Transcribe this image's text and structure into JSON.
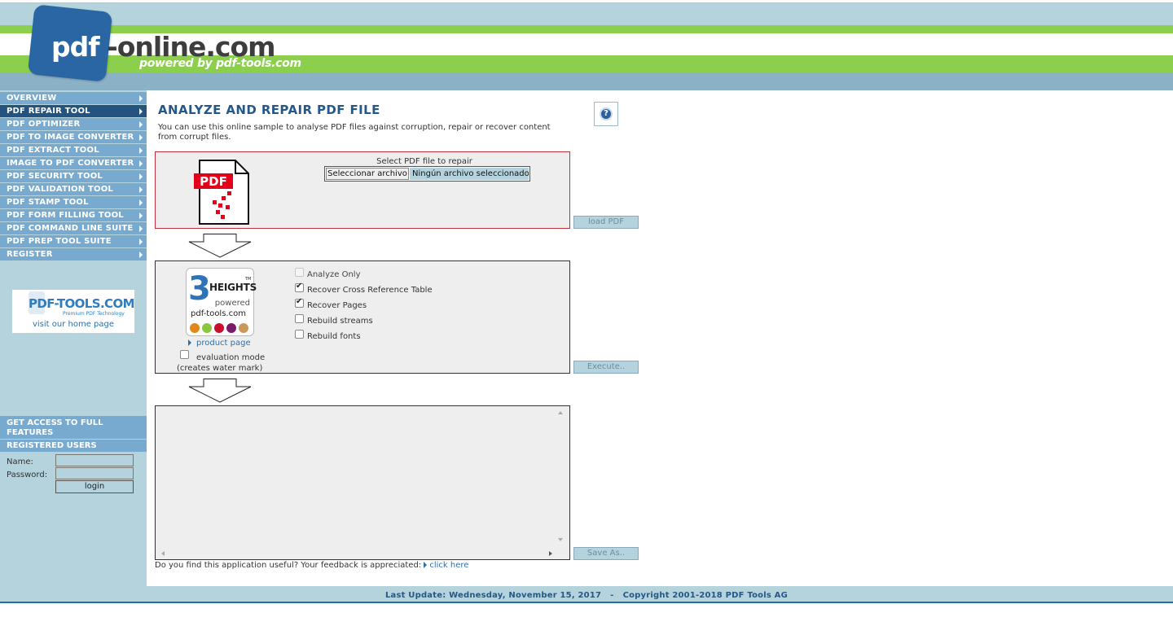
{
  "brand": {
    "logo_pdf": "pdf",
    "logo_rest": "-online.com",
    "powered": "powered by pdf-tools.com"
  },
  "nav": [
    {
      "label": "OVERVIEW",
      "active": false
    },
    {
      "label": "PDF REPAIR TOOL",
      "active": true
    },
    {
      "label": "PDF OPTIMIZER",
      "active": false
    },
    {
      "label": "PDF TO IMAGE CONVERTER",
      "active": false
    },
    {
      "label": "PDF EXTRACT TOOL",
      "active": false
    },
    {
      "label": "IMAGE TO PDF CONVERTER",
      "active": false
    },
    {
      "label": "PDF SECURITY TOOL",
      "active": false
    },
    {
      "label": "PDF VALIDATION TOOL",
      "active": false
    },
    {
      "label": "PDF STAMP TOOL",
      "active": false
    },
    {
      "label": "PDF FORM FILLING TOOL",
      "active": false
    },
    {
      "label": "PDF COMMAND LINE SUITE",
      "active": false
    },
    {
      "label": "PDF PREP TOOL SUITE",
      "active": false
    },
    {
      "label": "REGISTER",
      "active": false
    }
  ],
  "partner": {
    "logo": "PDF-TOOLS.COM",
    "tagline": "Premium PDF Technology",
    "visit": "visit our home page"
  },
  "access": {
    "heading": "GET ACCESS TO FULL FEATURES",
    "registered": "REGISTERED USERS",
    "name_label": "Name:",
    "password_label": "Password:",
    "login_label": "login",
    "name_value": "",
    "password_value": ""
  },
  "main": {
    "title": "ANALYZE AND REPAIR PDF FILE",
    "intro": "You can use this online sample to analyse PDF files against corruption, repair or recover content from corrupt files.",
    "help_icon": "question-icon",
    "pdf_icon_text": "PDF",
    "select_label": "Select PDF file to repair",
    "file_button": "Seleccionar archivo",
    "file_status": "Ningún archivo seleccionado",
    "load_button": "load PDF",
    "product": {
      "number": "3",
      "name": "HEIGHTS",
      "tm": "TM",
      "powered": "powered",
      "site": "pdf-tools.com",
      "dot_colors": [
        "#e2881b",
        "#8cc63f",
        "#c8102e",
        "#7b1c6b",
        "#c89a5a"
      ],
      "link": "product page"
    },
    "evaluation": {
      "label": "evaluation mode",
      "sub": "(creates water mark)",
      "checked": false
    },
    "options": [
      {
        "label": "Analyze Only",
        "checked": false,
        "disabled": true
      },
      {
        "label": "Recover Cross Reference Table",
        "checked": true,
        "disabled": false
      },
      {
        "label": "Recover Pages",
        "checked": true,
        "disabled": false
      },
      {
        "label": "Rebuild streams",
        "checked": false,
        "disabled": false
      },
      {
        "label": "Rebuild fonts",
        "checked": false,
        "disabled": false
      }
    ],
    "execute_button": "Execute..",
    "output_text": "",
    "save_button": "Save As..",
    "feedback_text": "Do you find this application useful? Your feedback is appreciated:",
    "feedback_link": "click here"
  },
  "footer": {
    "text": "Last Update: Wednesday, November 15, 2017   -   Copyright 2001-2018 PDF Tools AG"
  },
  "colors": {
    "nav_bg": "#78aad0",
    "nav_active": "#24537f",
    "accent_green": "#8bcf4d",
    "title_blue": "#24578a",
    "panel_red": "#c0303a"
  }
}
